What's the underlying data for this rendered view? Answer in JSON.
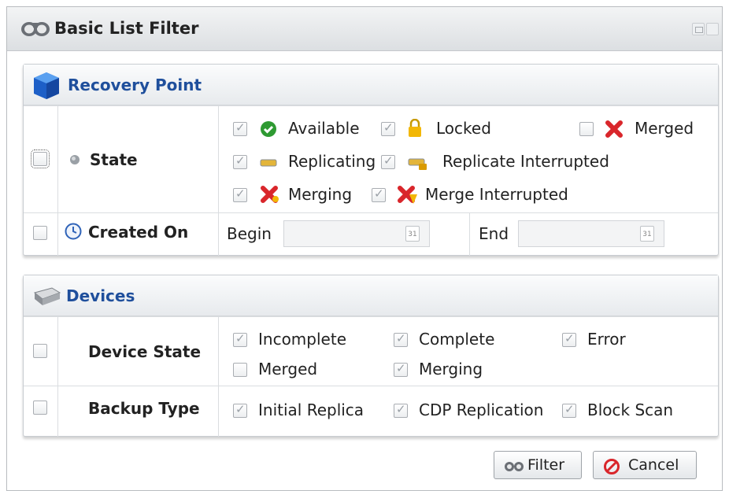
{
  "dialog": {
    "title": "Basic List Filter"
  },
  "recovery_point": {
    "title": "Recovery Point",
    "state": {
      "label": "State",
      "options": [
        {
          "label": "Available",
          "checked": true,
          "icon": "check-circle-icon"
        },
        {
          "label": "Locked",
          "checked": true,
          "icon": "lock-icon"
        },
        {
          "label": "Merged",
          "checked": false,
          "icon": "red-x-icon"
        },
        {
          "label": "Replicating",
          "checked": true,
          "icon": "replicating-icon"
        },
        {
          "label": "Replicate Interrupted",
          "checked": true,
          "icon": "replicate-interrupted-icon"
        },
        {
          "label": "Merging",
          "checked": true,
          "icon": "merging-icon"
        },
        {
          "label": "Merge Interrupted",
          "checked": true,
          "icon": "merge-interrupted-icon"
        }
      ]
    },
    "created_on": {
      "label": "Created On",
      "begin_label": "Begin",
      "end_label": "End",
      "begin_value": "",
      "end_value": ""
    }
  },
  "devices": {
    "title": "Devices",
    "device_state": {
      "label": "Device State",
      "options": [
        {
          "label": "Incomplete",
          "checked": true
        },
        {
          "label": "Complete",
          "checked": true
        },
        {
          "label": "Error",
          "checked": true
        },
        {
          "label": "Merged",
          "checked": false
        },
        {
          "label": "Merging",
          "checked": true
        }
      ]
    },
    "backup_type": {
      "label": "Backup Type",
      "options": [
        {
          "label": "Initial Replica",
          "checked": true
        },
        {
          "label": "CDP Replication",
          "checked": true
        },
        {
          "label": "Block Scan",
          "checked": true
        }
      ]
    }
  },
  "buttons": {
    "filter": "Filter",
    "cancel": "Cancel"
  },
  "colors": {
    "section_title": "#1f4f9c",
    "accent_red": "#d9262b",
    "success_green": "#2e9a32"
  }
}
